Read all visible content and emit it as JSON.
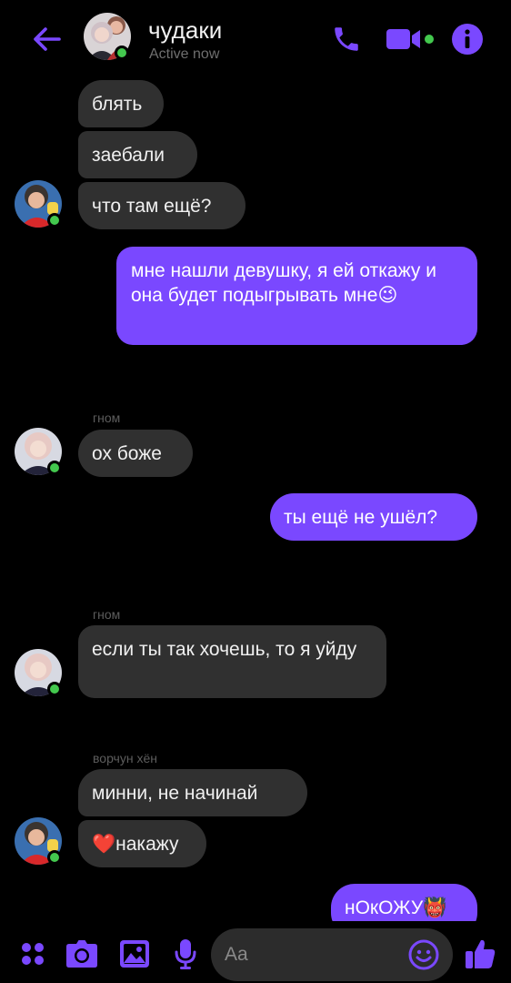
{
  "header": {
    "title": "чудаки",
    "status": "Active now"
  },
  "messages": [
    {
      "text": "блять",
      "side": "in"
    },
    {
      "text": "заебали",
      "side": "in"
    },
    {
      "text": "что там ещё?",
      "side": "in"
    },
    {
      "text": "мне нашли девушку, я ей откажу и она будет подыгрывать мне😉",
      "side": "out"
    },
    {
      "sender": "гном",
      "text": "ох боже",
      "side": "in"
    },
    {
      "text": "ты ещё не ушёл?",
      "side": "out"
    },
    {
      "sender": "гном",
      "text": "если ты так хочешь, то я уйду",
      "side": "in"
    },
    {
      "sender": "ворчун хён",
      "text": "минни, не начинай",
      "side": "in"
    },
    {
      "text": "❤️накажу",
      "side": "in"
    },
    {
      "text": "нОкОЖУ👹",
      "side": "out"
    }
  ],
  "composer": {
    "placeholder": "Aa"
  },
  "colors": {
    "accent": "#7a48ff",
    "incoming_bubble": "#303030",
    "online": "#43c84e",
    "background": "#000000"
  },
  "icons": [
    "back-arrow-icon",
    "phone-icon",
    "video-camera-icon",
    "info-icon",
    "apps-grid-icon",
    "camera-icon",
    "gallery-icon",
    "microphone-icon",
    "emoji-icon",
    "thumbs-up-icon"
  ]
}
